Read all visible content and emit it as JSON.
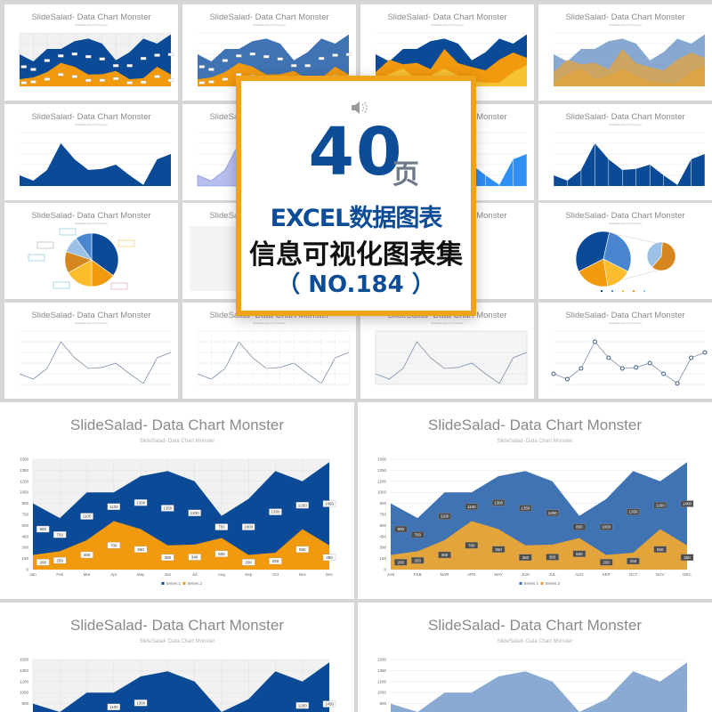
{
  "banner": {
    "count": "40",
    "unit": "页",
    "line1": "EXCEL数据图表",
    "line2": "信息可视化图表集",
    "line3": "（ NO.184 ）",
    "border_color": "#f0a21a",
    "text_color": "#0d4c97",
    "icon": "speaker-icon"
  },
  "colors": {
    "dark_blue": "#0b4a96",
    "orange": "#f29a0e",
    "light_blue": "#3f73b4",
    "gold": "#e2a43b",
    "yellow": "#f7c233",
    "bright_blue": "#2f8ff5",
    "line_gray": "#7f91aa"
  },
  "slide_title": "SlideSalad- Data Chart Monster",
  "slide_subtitle": "SlideSalad- Data Chart Monster",
  "thumbnails": [
    {
      "chart": 0,
      "style": "area-dark-labels"
    },
    {
      "chart": 0,
      "style": "area-light"
    },
    {
      "chart": 2,
      "style": "area-three"
    },
    {
      "chart": 2,
      "style": "area-three-transparent"
    },
    {
      "chart": 3,
      "style": "area-single-dark"
    },
    {
      "chart": 3,
      "style": "area-single-lavender"
    },
    {
      "chart": 3,
      "style": "area-single-bright"
    },
    {
      "chart": 3,
      "style": "area-single-vlines"
    },
    {
      "chart": 4,
      "style": "pie-callouts"
    },
    {
      "chart": -1,
      "style": "blank-block"
    },
    {
      "chart": -1,
      "style": "blank"
    },
    {
      "chart": 5,
      "style": "pie-of-pie"
    },
    {
      "chart": 3,
      "style": "line-plain"
    },
    {
      "chart": 3,
      "style": "line-vgrid"
    },
    {
      "chart": 3,
      "style": "line-gridbg"
    },
    {
      "chart": 3,
      "style": "line-markers"
    }
  ],
  "chart_data": [
    {
      "type": "area",
      "title": "SlideSalad- Data Chart Monster",
      "subtitle": "SlideSalad- Data Chart Monster",
      "categories": [
        "Jan",
        "Feb",
        "Mar",
        "Apr",
        "May",
        "Jun",
        "Jul",
        "Aug",
        "Sep",
        "Oct",
        "Nov",
        "Dec"
      ],
      "ylim": [
        0,
        1500
      ],
      "yticks": [
        "0",
        "150",
        "300",
        "450",
        "600",
        "750",
        "900",
        "1050",
        "1200",
        "1350",
        "1500"
      ],
      "grid": true,
      "legend": "bottom",
      "series": [
        {
          "name": "Series 1",
          "color": "#0b4a96",
          "values": [
            900,
            700,
            1050,
            1050,
            1270,
            1340,
            1200,
            730,
            960,
            1340,
            1200,
            1460
          ],
          "labels": [
            "900",
            "750",
            "1100",
            "1100",
            "1300",
            "1350",
            "1200",
            "750",
            "1000",
            "1350",
            "1200",
            "1450"
          ]
        },
        {
          "name": "Series 2",
          "color": "#f29a0e",
          "values": [
            200,
            250,
            400,
            660,
            550,
            330,
            340,
            430,
            200,
            230,
            550,
            330
          ],
          "labels": [
            "200",
            "250",
            "450",
            "700",
            "550",
            "350",
            "340",
            "500",
            "200",
            "250",
            "550",
            "350"
          ]
        }
      ]
    },
    {
      "type": "area",
      "title": "SlideSalad- Data Chart Monster",
      "subtitle": "SlideSalad- Data Chart Monster",
      "categories": [
        "JAN",
        "FEB",
        "MAR",
        "APR",
        "MAY",
        "JUN",
        "JUL",
        "AUG",
        "SEP",
        "OCT",
        "NOV",
        "DEC"
      ],
      "ylim": [
        0,
        1500
      ],
      "yticks": [
        "0",
        "150",
        "300",
        "450",
        "600",
        "750",
        "900",
        "1050",
        "1200",
        "1350",
        "1500"
      ],
      "grid": true,
      "legend": "bottom",
      "series": [
        {
          "name": "Series 1",
          "color": "#3f73b4",
          "values": [
            900,
            700,
            1050,
            1050,
            1270,
            1340,
            1200,
            730,
            960,
            1340,
            1200,
            1460
          ],
          "labels": [
            "900",
            "750",
            "1100",
            "1100",
            "1300",
            "1350",
            "1200",
            "800",
            "1000",
            "1350",
            "1200",
            "1400"
          ]
        },
        {
          "name": "Series 2",
          "color": "#e2a43b",
          "values": [
            200,
            250,
            400,
            660,
            550,
            330,
            340,
            430,
            200,
            230,
            550,
            330
          ],
          "labels": [
            "200",
            "250",
            "450",
            "700",
            "550",
            "350",
            "360",
            "500",
            "200",
            "250",
            "550",
            "350"
          ]
        }
      ]
    },
    {
      "type": "area",
      "categories": [
        "Jan",
        "Feb",
        "Mar",
        "Apr",
        "May",
        "Jun",
        "Jul",
        "Aug",
        "Sep",
        "Oct",
        "Nov",
        "Dec"
      ],
      "ylim": [
        0,
        1500
      ],
      "series": [
        {
          "color": "#0b4a96",
          "values": [
            900,
            700,
            1050,
            1050,
            1270,
            1340,
            1200,
            730,
            960,
            1340,
            1200,
            1460
          ]
        },
        {
          "color": "#f29a0e",
          "values": [
            400,
            750,
            620,
            660,
            480,
            1050,
            650,
            540,
            450,
            750,
            950,
            800
          ]
        },
        {
          "color": "#f7c233",
          "values": [
            100,
            350,
            500,
            200,
            300,
            500,
            300,
            150,
            100,
            100,
            400,
            600
          ]
        }
      ]
    },
    {
      "type": "line",
      "categories": [
        "Jan",
        "Feb",
        "Mar",
        "Apr",
        "May",
        "Jun",
        "Jul",
        "Aug",
        "Sep",
        "Oct",
        "Nov",
        "Dec"
      ],
      "ylim": [
        0,
        500
      ],
      "series": [
        {
          "color": "#0b4a96",
          "values": [
            100,
            50,
            150,
            400,
            250,
            150,
            160,
            200,
            100,
            10,
            250,
            300
          ]
        }
      ]
    },
    {
      "type": "pie",
      "values": [
        35,
        15,
        17,
        13,
        10,
        10
      ],
      "colors": [
        "#0b4a96",
        "#f29a0e",
        "#fbbd2e",
        "#d4861f",
        "#9bc2e6",
        "#4a86cf"
      ]
    },
    {
      "type": "pie",
      "values": [
        36,
        29,
        15,
        20
      ],
      "colors": [
        "#0b4a96",
        "#4a86cf",
        "#fbbd2e",
        "#f29a0e"
      ],
      "secondary": {
        "values": [
          60,
          40
        ],
        "colors": [
          "#d4861f",
          "#9bc2e6"
        ]
      }
    }
  ],
  "bottom": [
    {
      "chart": 0,
      "style": "big-dark"
    },
    {
      "chart": 1,
      "style": "big-light"
    },
    {
      "chart": 0,
      "style": "big-dark"
    },
    {
      "chart": 1,
      "style": "big-light-transparent"
    }
  ]
}
